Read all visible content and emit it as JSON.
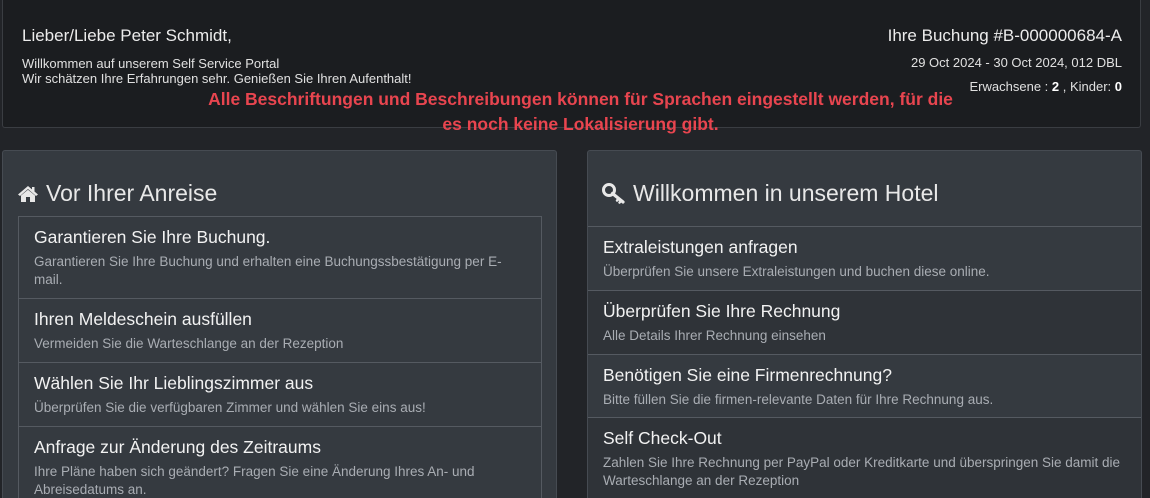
{
  "header": {
    "greeting": "Lieber/Liebe Peter Schmidt,",
    "welcome_line1": "Willkommen auf unserem Self Service Portal",
    "welcome_line2": "Wir schätzen Ihre Erfahrungen sehr. Genießen Sie Ihren Aufenthalt!",
    "notice": "Alle Beschriftungen und Beschreibungen können für Sprachen eingestellt werden, für die es noch keine Lokalisierung gibt.",
    "booking_title": "Ihre Buchung #B-000000684-A",
    "booking_dates": "29 Oct 2024 - 30 Oct 2024, 012 DBL",
    "adults_label": "Erwachsene : ",
    "adults_value": "2",
    "children_label": " , Kinder: ",
    "children_value": "0"
  },
  "left_panel": {
    "icon": "home-icon",
    "title": "Vor Ihrer Anreise",
    "items": [
      {
        "title": "Garantieren Sie Ihre Buchung.",
        "desc": "Garantieren Sie Ihre Buchung und erhalten eine Buchungssbestätigung per E-mail."
      },
      {
        "title": "Ihren Meldeschein ausfüllen",
        "desc": "Vermeiden Sie die Warteschlange an der Rezeption"
      },
      {
        "title": "Wählen Sie Ihr Lieblingszimmer aus",
        "desc": "Überprüfen Sie die verfügbaren Zimmer und wählen Sie eins aus!"
      },
      {
        "title": "Anfrage zur Änderung des Zeitraums",
        "desc": "Ihre Pläne haben sich geändert? Fragen Sie eine Änderung Ihres An- und Abreisedatums an."
      }
    ]
  },
  "right_panel": {
    "icon": "key-icon",
    "title": "Willkommen in unserem Hotel",
    "items": [
      {
        "title": "Extraleistungen anfragen",
        "desc": "Überprüfen Sie unsere Extraleistungen und buchen diese online."
      },
      {
        "title": "Überprüfen Sie Ihre Rechnung",
        "desc": "Alle Details Ihrer Rechnung einsehen"
      },
      {
        "title": "Benötigen Sie eine Firmenrechnung?",
        "desc": "Bitte füllen Sie die firmen-relevante Daten für Ihre Rechnung aus."
      },
      {
        "title": "Self Check-Out",
        "desc": "Zahlen Sie Ihre Rechnung per PayPal oder Kreditkarte und überspringen Sie damit die Warteschlange an der Rezeption"
      }
    ]
  }
}
